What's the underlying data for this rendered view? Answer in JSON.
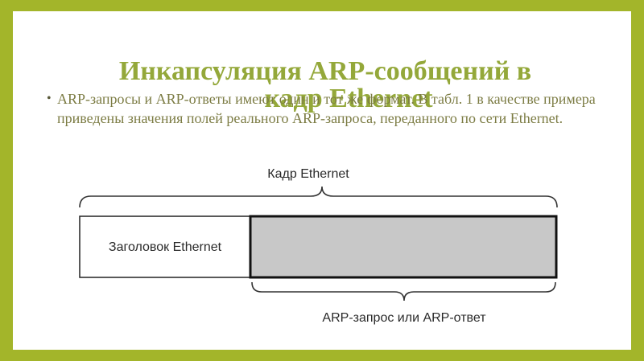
{
  "slide": {
    "title_line1": "Инкапсуляция ARP-сообщений в",
    "title_line2": "кадр Ethernet",
    "bullet_text": "ARP-запросы и ARP-ответы имеют один и тот же формат. В табл. 1 в качестве примера приведены значения полей реального ARP-запроса, переданного по сети Ethernet.",
    "colors": {
      "frame_background": "#a3b52a",
      "title": "#94a83a",
      "body_text": "#7c7c44",
      "payload_fill": "#c8c8c8"
    }
  },
  "diagram": {
    "frame_label": "Кадр Ethernet",
    "header_label": "Заголовок Ethernet",
    "payload_label": "ARP-запрос или ARP-ответ"
  }
}
